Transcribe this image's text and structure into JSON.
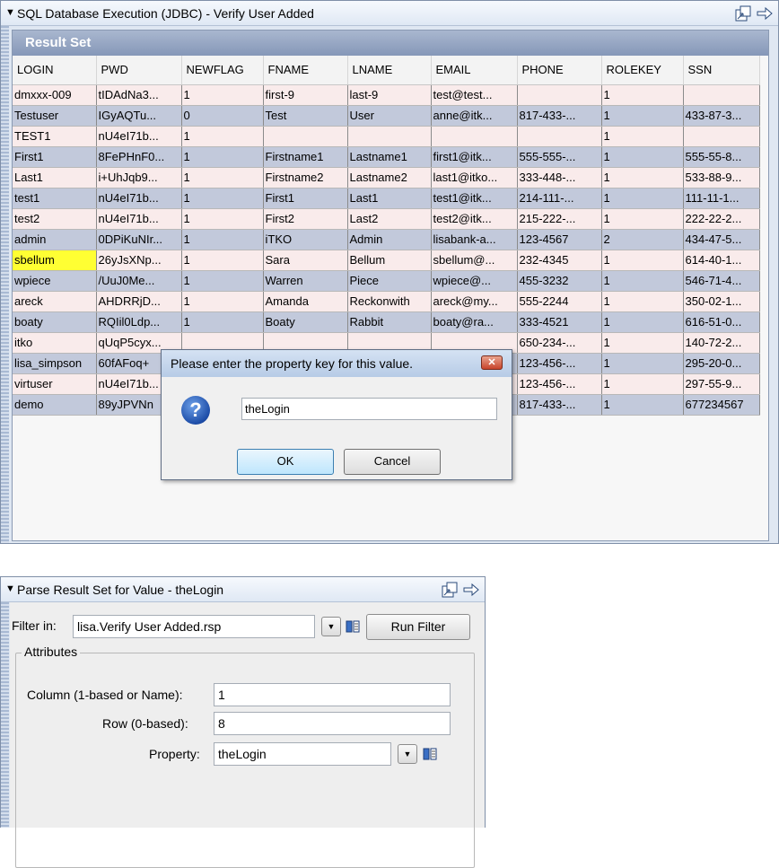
{
  "panel1": {
    "title": "SQL Database Execution (JDBC) - Verify User Added",
    "result_set_label": "Result Set",
    "columns": [
      "LOGIN",
      "PWD",
      "NEWFLAG",
      "FNAME",
      "LNAME",
      "EMAIL",
      "PHONE",
      "ROLEKEY",
      "SSN"
    ],
    "rows": [
      [
        "dmxxx-009",
        "tIDAdNa3...",
        "1",
        "first-9",
        "last-9",
        "test@test...",
        "",
        "1",
        ""
      ],
      [
        "Testuser",
        "IGyAQTu...",
        "0",
        "Test",
        "User",
        "anne@itk...",
        "817-433-...",
        "1",
        "433-87-3..."
      ],
      [
        "TEST1",
        "nU4eI71b...",
        "1",
        "",
        "",
        "",
        "",
        "1",
        ""
      ],
      [
        "First1",
        "8FePHnF0...",
        "1",
        "Firstname1",
        "Lastname1",
        "first1@itk...",
        "555-555-...",
        "1",
        "555-55-8..."
      ],
      [
        "Last1",
        "i+UhJqb9...",
        "1",
        "Firstname2",
        "Lastname2",
        "last1@itko...",
        "333-448-...",
        "1",
        "533-88-9..."
      ],
      [
        "test1",
        "nU4eI71b...",
        "1",
        "First1",
        "Last1",
        "test1@itk...",
        "214-111-...",
        "1",
        "111-11-1..."
      ],
      [
        "test2",
        "nU4eI71b...",
        "1",
        "First2",
        "Last2",
        "test2@itk...",
        "215-222-...",
        "1",
        "222-22-2..."
      ],
      [
        "admin",
        "0DPiKuNIr...",
        "1",
        "iTKO",
        "Admin",
        "lisabank-a...",
        "123-4567",
        "2",
        "434-47-5..."
      ],
      [
        "sbellum",
        "26yJsXNp...",
        "1",
        "Sara",
        "Bellum",
        "sbellum@...",
        "232-4345",
        "1",
        "614-40-1..."
      ],
      [
        "wpiece",
        "/UuJ0Me...",
        "1",
        "Warren",
        "Piece",
        "wpiece@...",
        "455-3232",
        "1",
        "546-71-4..."
      ],
      [
        "areck",
        "AHDRRjD...",
        "1",
        "Amanda",
        "Reckonwith",
        "areck@my...",
        "555-2244",
        "1",
        "350-02-1..."
      ],
      [
        "boaty",
        "RQIil0Ldp...",
        "1",
        "Boaty",
        "Rabbit",
        "boaty@ra...",
        "333-4521",
        "1",
        "616-51-0..."
      ],
      [
        "itko",
        "qUqP5cyx...",
        "",
        "",
        "",
        "",
        "650-234-...",
        "1",
        "140-72-2..."
      ],
      [
        "lisa_simpson",
        "60fAFoq+",
        "",
        "",
        "",
        "",
        "123-456-...",
        "1",
        "295-20-0..."
      ],
      [
        "virtuser",
        "nU4eI71b...",
        "",
        "",
        "",
        "",
        "123-456-...",
        "1",
        "297-55-9..."
      ],
      [
        "demo",
        "89yJPVNn",
        "",
        "",
        "",
        "",
        "817-433-...",
        "1",
        "677234567"
      ]
    ]
  },
  "dialog": {
    "title": "Please enter the property key for this value.",
    "input_value": "theLogin",
    "ok_label": "OK",
    "cancel_label": "Cancel",
    "close_glyph": "✕",
    "icon_glyph": "?"
  },
  "panel2": {
    "title": "Parse Result Set for Value - theLogin",
    "filter_label": "Filter in:",
    "filter_value": "lisa.Verify User Added.rsp",
    "run_filter_label": "Run Filter",
    "attributes_label": "Attributes",
    "column_label": "Column (1-based or Name):",
    "column_value": "1",
    "row_label": "Row (0-based):",
    "row_value": "8",
    "property_label": "Property:",
    "property_value": "theLogin"
  },
  "ui": {
    "collapse_glyph": "▼",
    "dropdown_glyph": "▼",
    "highlight_color": "#ffff33"
  }
}
